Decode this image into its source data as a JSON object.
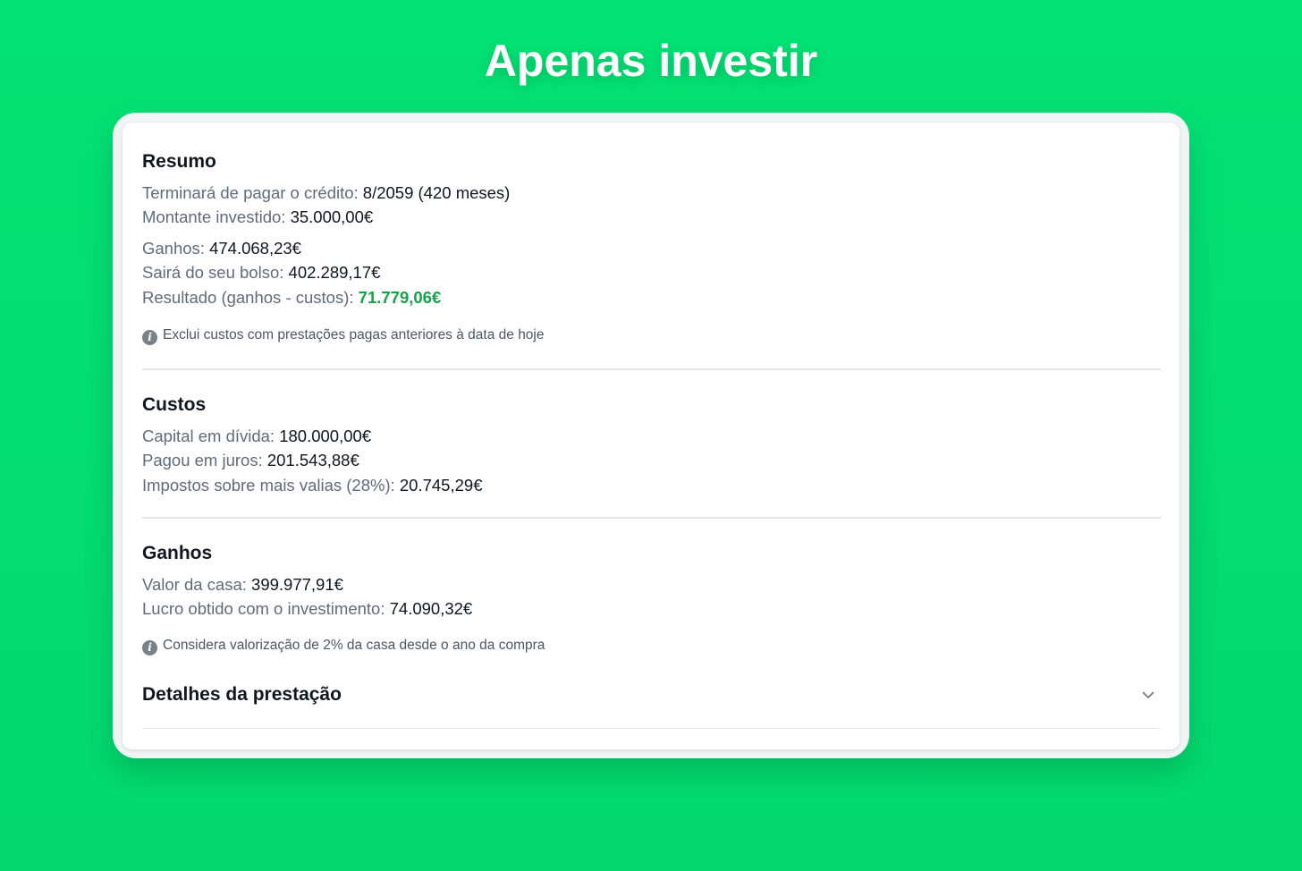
{
  "page": {
    "title": "Apenas investir"
  },
  "resumo": {
    "title": "Resumo",
    "rows": [
      {
        "label": "Terminará de pagar o crédito:",
        "value": "8/2059 (420 meses)"
      },
      {
        "label": "Montante investido:",
        "value": "35.000,00€"
      },
      {
        "label": "Ganhos:",
        "value": "474.068,23€"
      },
      {
        "label": "Sairá do seu bolso:",
        "value": "402.289,17€"
      },
      {
        "label": "Resultado (ganhos - custos):",
        "value": "71.779,06€"
      }
    ],
    "note": "Exclui custos com prestações pagas anteriores à data de hoje"
  },
  "custos": {
    "title": "Custos",
    "rows": [
      {
        "label": "Capital em dívida:",
        "value": "180.000,00€"
      },
      {
        "label": "Pagou em juros:",
        "value": "201.543,88€"
      },
      {
        "label": "Impostos sobre mais valias (28%):",
        "value": "20.745,29€"
      }
    ]
  },
  "ganhos": {
    "title": "Ganhos",
    "rows": [
      {
        "label": "Valor da casa:",
        "value": "399.977,91€"
      },
      {
        "label": "Lucro obtido com o investimento:",
        "value": "74.090,32€"
      }
    ],
    "note": "Considera valorização de 2% da casa desde o ano da compra"
  },
  "detalhes": {
    "title": "Detalhes da prestação",
    "icon": "chevron-down-icon",
    "expanded": false
  },
  "colors": {
    "background": "#03e274",
    "result_positive": "#16a34a",
    "label": "#5f6b7a",
    "value": "#0f1720"
  },
  "icons": {
    "info": "info-icon"
  }
}
